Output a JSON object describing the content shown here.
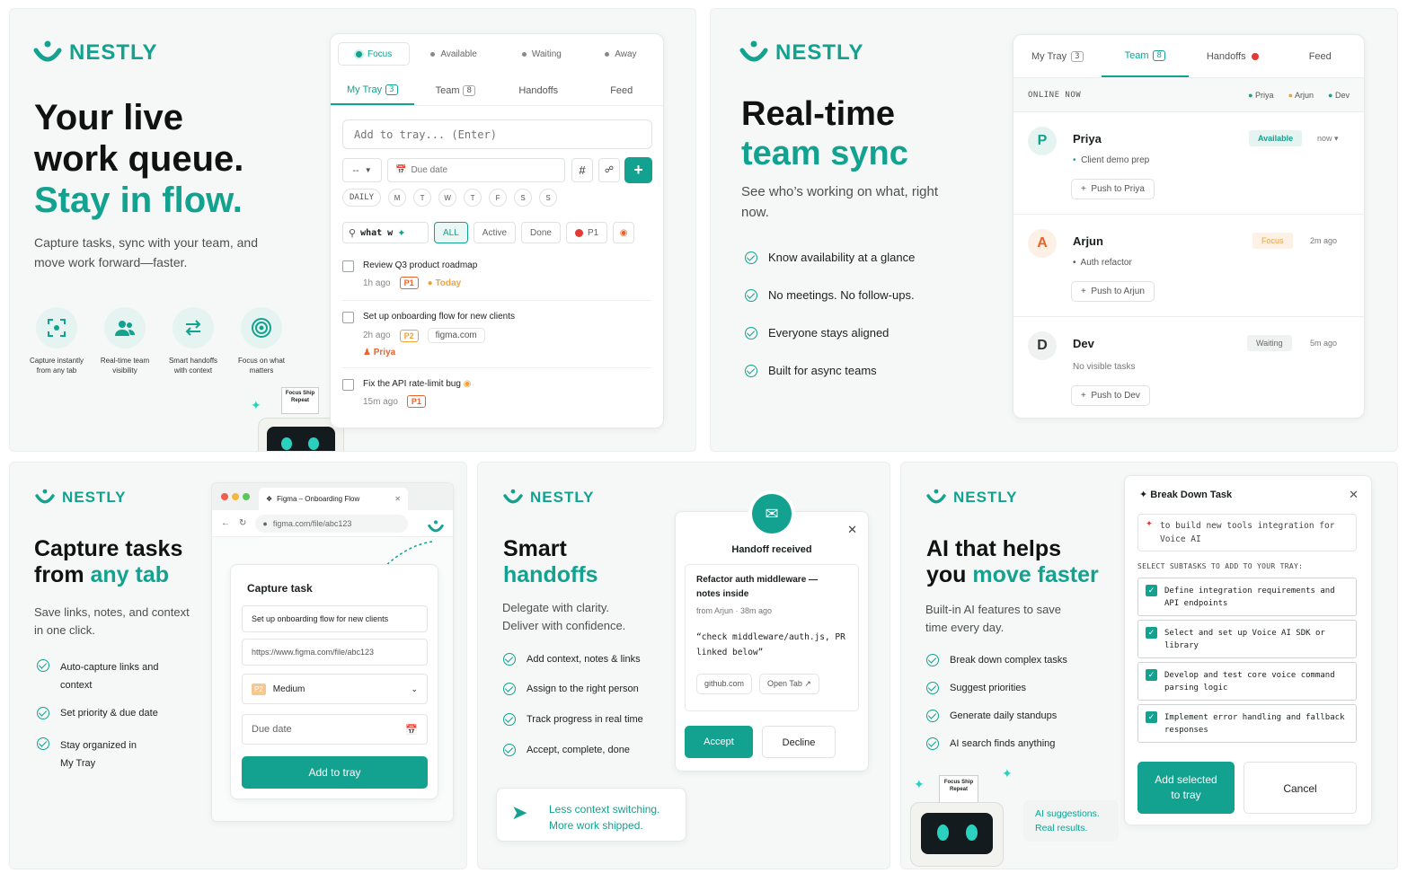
{
  "brand": {
    "name": "NESTLY",
    "color": "#12a28f",
    "accent_orange": "#e9632e"
  },
  "p1": {
    "headline_line1": "Your live",
    "headline_line2": "work queue.",
    "headline_accent": "Stay in flow.",
    "subtext": "Capture tasks, sync with your team, and move work forward—faster.",
    "icons": [
      {
        "icon": "scan-icon",
        "label": "Capture instantly from any tab"
      },
      {
        "icon": "team-icon",
        "label": "Real-time team visibility"
      },
      {
        "icon": "swap-icon",
        "label": "Smart handoffs with context"
      },
      {
        "icon": "target-icon",
        "label": "Focus on what matters"
      }
    ],
    "robot_sign": "Focus Ship Repeat",
    "app": {
      "status": [
        "Focus",
        "Available",
        "Waiting",
        "Away"
      ],
      "tabs": [
        {
          "label": "My Tray",
          "badge": "3"
        },
        {
          "label": "Team",
          "badge": "8"
        },
        {
          "label": "Handoffs",
          "badge": ""
        },
        {
          "label": "Feed",
          "badge": ""
        }
      ],
      "add_placeholder": "Add to tray... (Enter)",
      "priority_select": "--",
      "due_placeholder": "Due date",
      "repeat_label": "DAILY",
      "days": [
        "M",
        "T",
        "W",
        "T",
        "F",
        "S",
        "S"
      ],
      "search_value": "what w",
      "filters": [
        "ALL",
        "Active",
        "Done",
        "P1"
      ],
      "tasks": [
        {
          "title": "Review Q3 product roadmap",
          "time": "1h ago",
          "priority": "P1",
          "extra": "Today"
        },
        {
          "title": "Set up onboarding flow for new clients",
          "time": "2h ago",
          "priority": "P2",
          "extra": "figma.com",
          "assignee": "Priya"
        },
        {
          "title": "Fix the API rate-limit bug",
          "time": "15m ago",
          "priority": "P1"
        }
      ]
    }
  },
  "p2": {
    "headline_line1": "Real-time",
    "headline_accent": "team sync",
    "subtext": "See who’s working on what, right now.",
    "features": [
      "Know availability at a glance",
      "No meetings. No follow-ups.",
      "Everyone stays aligned",
      "Built for async teams"
    ],
    "app": {
      "tabs": [
        {
          "label": "My Tray",
          "badge": "3"
        },
        {
          "label": "Team",
          "badge": "8"
        },
        {
          "label": "Handoffs",
          "badge": ""
        },
        {
          "label": "Feed",
          "badge": ""
        }
      ],
      "online_label": "ONLINE NOW",
      "online": [
        "Priya",
        "Arjun",
        "Dev"
      ],
      "members": [
        {
          "initial": "P",
          "name": "Priya",
          "status": "Available",
          "time": "now",
          "task": "Client demo prep",
          "push": "Push to Priya"
        },
        {
          "initial": "A",
          "name": "Arjun",
          "status": "Focus",
          "time": "2m ago",
          "task": "Auth refactor",
          "push": "Push to Arjun"
        },
        {
          "initial": "D",
          "name": "Dev",
          "status": "Waiting",
          "time": "5m ago",
          "task": "No visible tasks",
          "push": "Push to Dev"
        }
      ]
    }
  },
  "p3": {
    "headline_line1": "Capture tasks",
    "headline_line2_pre": "from ",
    "headline_accent": "any tab",
    "subtext": "Save links, notes, and context in one click.",
    "features": [
      "Auto-capture links and context",
      "Set priority & due date",
      "Stay organized in My Tray"
    ],
    "browser": {
      "tab_title": "Figma – Onboarding Flow",
      "url": "figma.com/file/abc123",
      "form_title": "Capture task",
      "task_value": "Set up onboarding flow for new clients",
      "link_value": "https://www.figma.com/file/abc123",
      "priority_badge": "P2",
      "priority_value": "Medium",
      "due_placeholder": "Due date",
      "submit": "Add to tray"
    }
  },
  "p4": {
    "headline_line1": "Smart",
    "headline_accent": "handoffs",
    "subtext": "Delegate with clarity. Deliver with confidence.",
    "features": [
      "Add context, notes & links",
      "Assign to the right person",
      "Track progress in real time",
      "Accept, complete, done"
    ],
    "banner_line1": "Less context switching.",
    "banner_line2": "More work shipped.",
    "modal": {
      "title": "Handoff received",
      "task_title": "Refactor auth middleware — notes inside",
      "meta": "from Arjun · 38m ago",
      "note": "“check middleware/auth.js, PR linked below”",
      "link": "github.com",
      "open_tab": "Open Tab",
      "accept": "Accept",
      "decline": "Decline"
    }
  },
  "p5": {
    "headline_line1": "AI that helps",
    "headline_line2_pre": "you ",
    "headline_accent": "move faster",
    "subtext": "Built-in AI features to save time every day.",
    "features": [
      "Break down complex tasks",
      "Suggest priorities",
      "Generate daily standups",
      "AI search finds anything"
    ],
    "bubble_line1": "AI suggestions.",
    "bubble_line2": "Real results.",
    "robot_sign": "Focus Ship Repeat",
    "modal": {
      "title": "Break Down Task",
      "prompt": "to build new tools integration for Voice AI",
      "select_label": "SELECT SUBTASKS TO ADD TO YOUR TRAY:",
      "subtasks": [
        "Define integration requirements and API endpoints",
        "Select and set up Voice AI SDK or library",
        "Develop and test core voice command parsing logic",
        "Implement error handling and fallback responses"
      ],
      "add": "Add selected to tray",
      "cancel": "Cancel"
    }
  }
}
